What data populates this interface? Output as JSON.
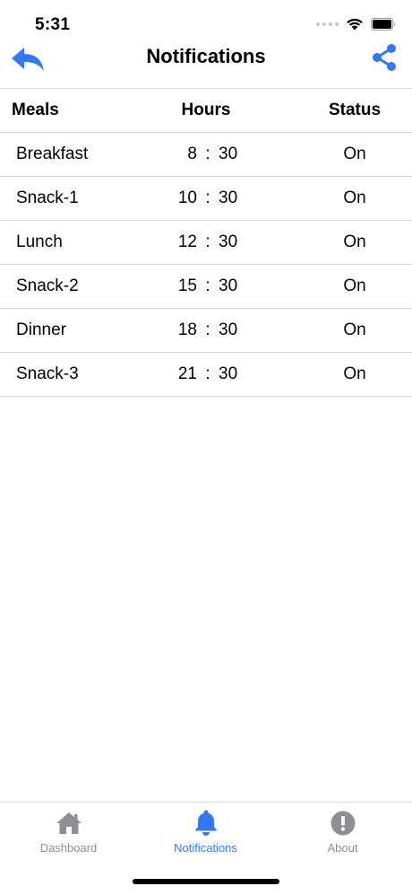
{
  "status_bar": {
    "time": "5:31"
  },
  "nav": {
    "title": "Notifications"
  },
  "table": {
    "columns": {
      "meals": "Meals",
      "hours": "Hours",
      "status": "Status"
    },
    "rows": [
      {
        "meal": "Breakfast",
        "hour": "8",
        "sep": ":",
        "minute": "30",
        "status": "On"
      },
      {
        "meal": "Snack-1",
        "hour": "10",
        "sep": ":",
        "minute": "30",
        "status": "On"
      },
      {
        "meal": "Lunch",
        "hour": "12",
        "sep": ":",
        "minute": "30",
        "status": "On"
      },
      {
        "meal": "Snack-2",
        "hour": "15",
        "sep": ":",
        "minute": "30",
        "status": "On"
      },
      {
        "meal": "Dinner",
        "hour": "18",
        "sep": ":",
        "minute": "30",
        "status": "On"
      },
      {
        "meal": "Snack-3",
        "hour": "21",
        "sep": ":",
        "minute": "30",
        "status": "On"
      }
    ]
  },
  "tabs": [
    {
      "label": "Dashboard",
      "icon": "home-icon",
      "active": false
    },
    {
      "label": "Notifications",
      "icon": "bell-icon",
      "active": true
    },
    {
      "label": "About",
      "icon": "info-icon",
      "active": false
    }
  ],
  "colors": {
    "accent": "#3478f6",
    "inactive": "#8e8e93",
    "divider": "#d6d6d6"
  }
}
